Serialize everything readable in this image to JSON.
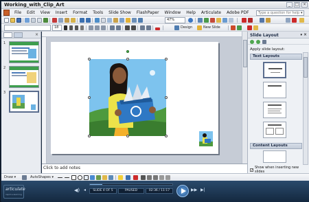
{
  "window": {
    "title": "Working_with_Clip_Art",
    "controls": [
      "_",
      "□",
      "×"
    ]
  },
  "menu": {
    "items": [
      "File",
      "Edit",
      "View",
      "Insert",
      "Format",
      "Tools",
      "Slide Show",
      "FlashPaper",
      "Window",
      "Help",
      "Articulate",
      "Adobe PDF"
    ],
    "help_placeholder": "Type a question for help",
    "help_dropdown": "▾"
  },
  "toolbar": {
    "zoom": "47%",
    "font_size": "18",
    "design_label": "Design",
    "new_slide_label": "New Slide"
  },
  "outline": {
    "close": "×",
    "slides": [
      {
        "num": "1"
      },
      {
        "num": "2"
      },
      {
        "num": "3"
      }
    ]
  },
  "slide": {
    "notes_placeholder": "Click to add notes"
  },
  "task_pane": {
    "title": "Slide Layout",
    "apply_label": "Apply slide layout:",
    "section_text": "Text Layouts",
    "section_content": "Content Layouts",
    "show_checkbox": "Show when inserting new slides",
    "checked": true
  },
  "drawbar": {
    "draw_label": "Draw ▾",
    "autoshapes_label": "AutoShapes ▾"
  },
  "player": {
    "logo_text": "articulate",
    "logo_sub": "rapid e-learning",
    "slide_counter": "SLIDE 4 OF 5",
    "status": "PAUSED",
    "time": "02:36 / 11:17",
    "progress": 0.15
  }
}
